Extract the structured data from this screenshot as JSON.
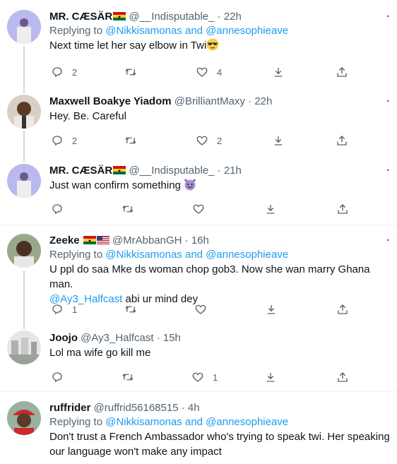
{
  "tweets": [
    {
      "name": "MR. CÆSÄR",
      "handle": "@__Indisputable_",
      "dot": "·",
      "time": "22h",
      "reply_prefix": "Replying to ",
      "reply_mentions": "@Nikkisamonas and @annesophieave",
      "text": "Next time let her say elbow in Twi",
      "reply_count": "2",
      "retweet_count": "",
      "like_count": "4",
      "avatar_color": "#8f8fd6"
    },
    {
      "name": "Maxwell Boakye Yiadom",
      "handle": "@BrilliantMaxy",
      "dot": "·",
      "time": "22h",
      "text": "Hey. Be. Careful",
      "reply_count": "2",
      "retweet_count": "",
      "like_count": "2",
      "avatar_color": "#6b4a2e"
    },
    {
      "name": "MR. CÆSÄR",
      "handle": "@__Indisputable_",
      "dot": "·",
      "time": "21h",
      "text": "Just wan confirm something",
      "reply_count": "",
      "retweet_count": "",
      "like_count": "",
      "avatar_color": "#8f8fd6"
    },
    {
      "name": "Zeeke",
      "handle": "@MrAbbanGH",
      "dot": "·",
      "time": "16h",
      "reply_prefix": "Replying to ",
      "reply_mentions": "@Nikkisamonas and @annesophieave",
      "text": "U ppl do saa Mke ds woman chop gob3. Now she wan marry Ghana man.",
      "text_mention": "@Ay3_Halfcast",
      "text_suffix": " abi ur mind dey",
      "reply_count": "1",
      "retweet_count": "",
      "like_count": "",
      "avatar_color": "#7a8a6a"
    },
    {
      "name": "Joojo",
      "handle": "@Ay3_Halfcast",
      "dot": "·",
      "time": "15h",
      "text": "Lol ma wife go kill me",
      "reply_count": "",
      "retweet_count": "",
      "like_count": "1",
      "avatar_color": "#b8b8b8"
    },
    {
      "name": "ruffrider",
      "handle": "@ruffrid56168515",
      "dot": "·",
      "time": "4h",
      "reply_prefix": "Replying to ",
      "reply_mentions": "@Nikkisamonas and @annesophieave",
      "text": "Don't trust a French Ambassador who's trying to speak twi. Her speaking our language won't make any impact",
      "avatar_color": "#cc3333"
    }
  ],
  "more_label": "·",
  "colors": {
    "accent": "#1d9bf0",
    "muted": "#536471",
    "text": "#0f1419",
    "line": "#cfd9de"
  },
  "icons": [
    "reply-icon",
    "retweet-icon",
    "like-icon",
    "download-icon",
    "share-icon",
    "sunglasses-emoji",
    "devil-emoji",
    "ghana-flag",
    "us-flag",
    "more-icon"
  ]
}
